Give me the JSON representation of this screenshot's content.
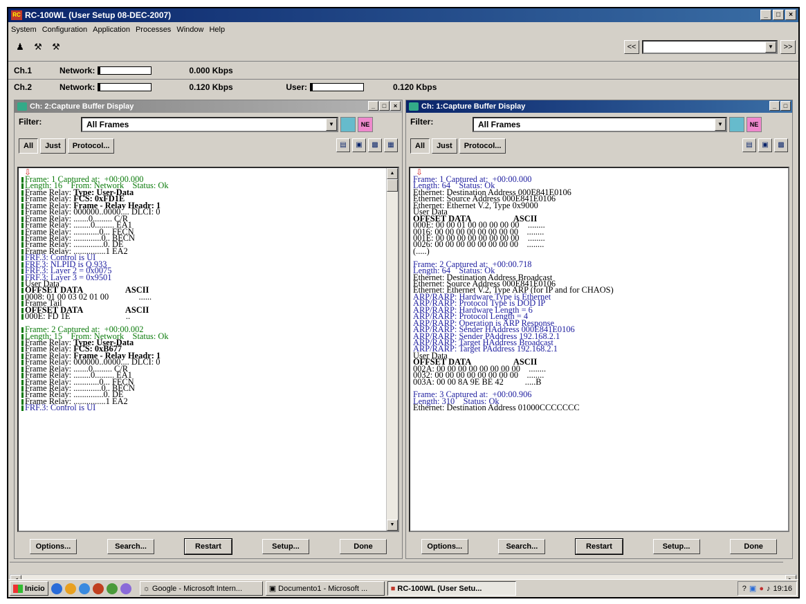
{
  "app": {
    "title": "RC-100WL (User Setup 08-DEC-2007)",
    "logo_text": "RC",
    "window_buttons": [
      "_",
      "□",
      "×"
    ]
  },
  "menu": [
    "System",
    "Configuration",
    "Application",
    "Processes",
    "Window",
    "Help"
  ],
  "nav": {
    "back": "<<",
    "forward": ">>",
    "combo_value": ""
  },
  "channels": [
    {
      "label": "Ch.1",
      "network_label": "Network:",
      "network_rate": "0.000 Kbps"
    },
    {
      "label": "Ch.2",
      "network_label": "Network:",
      "network_rate": "0.120 Kbps",
      "user_label": "User:",
      "user_rate": "0.120 Kbps"
    }
  ],
  "left_window": {
    "title": "Ch: 2:Capture Buffer Display",
    "filter_label": "Filter:",
    "filter_value": "All Frames",
    "buttons": {
      "all": "All",
      "just": "Just",
      "protocol": "Protocol..."
    },
    "lines": [
      {
        "c": "green",
        "t": "Frame: 1 Captured at:  +00:00.000",
        "m": true
      },
      {
        "c": "green",
        "t": "Length: 16    From: Network    Status: Ok",
        "m": true
      },
      {
        "c": "black",
        "t": "Frame Relay: ",
        "b": "Type: User-Data",
        "m": true
      },
      {
        "c": "black",
        "t": "Frame Relay: ",
        "b": "FCS: 0xFD1E",
        "m": true
      },
      {
        "c": "black",
        "t": "Frame Relay: ",
        "b": "Frame - Relay Headr: 1",
        "m": true
      },
      {
        "c": "black",
        "t": "Frame Relay: 000000..0000.... DLCI: 0",
        "m": true
      },
      {
        "c": "black",
        "t": "Frame Relay: .......0......... C/R",
        "m": true
      },
      {
        "c": "black",
        "t": "Frame Relay: ........0......... EA1",
        "m": true
      },
      {
        "c": "black",
        "t": "Frame Relay: ............0... FECN",
        "m": true
      },
      {
        "c": "black",
        "t": "Frame Relay: .............0.. BECN",
        "m": true
      },
      {
        "c": "black",
        "t": "Frame Relay: ..............0. DE",
        "m": true
      },
      {
        "c": "black",
        "t": "Frame Relay: ...............1 EA2",
        "m": true
      },
      {
        "c": "blue",
        "t": "FRF.3: Control is UI",
        "m": true
      },
      {
        "c": "blue",
        "t": "FRF.3: NLPID is Q.933",
        "m": true
      },
      {
        "c": "blue",
        "t": "FRF.3: Layer 2 = 0x0075",
        "m": true
      },
      {
        "c": "blue",
        "t": "FRF.3: Layer 3 = 0x9501",
        "m": true
      },
      {
        "c": "black",
        "t": "User Data",
        "m": true
      },
      {
        "c": "black",
        "t": "",
        "b": "OFFSET DATA                    ASCII",
        "m": true
      },
      {
        "c": "black",
        "t": "0008: 01 00 03 02 01 00              ......",
        "m": true
      },
      {
        "c": "black",
        "t": "Frame Tail",
        "m": true
      },
      {
        "c": "black",
        "t": "",
        "b": "OFFSET DATA                    ASCII",
        "m": true
      },
      {
        "c": "black",
        "t": "000E: FD 1E                          ..",
        "m": true
      },
      {
        "c": "black",
        "t": "",
        "m": false
      },
      {
        "c": "green",
        "t": "Frame: 2 Captured at:  +00:00.002",
        "m": true
      },
      {
        "c": "green",
        "t": "Length: 15    From: Network    Status: Ok",
        "m": true
      },
      {
        "c": "black",
        "t": "Frame Relay: ",
        "b": "Type: User-Data",
        "m": true
      },
      {
        "c": "black",
        "t": "Frame Relay: ",
        "b": "FCS: 0xB677",
        "m": true
      },
      {
        "c": "black",
        "t": "Frame Relay: ",
        "b": "Frame - Relay Headr: 1",
        "m": true
      },
      {
        "c": "black",
        "t": "Frame Relay: 000000..0000.... DLCI: 0",
        "m": true
      },
      {
        "c": "black",
        "t": "Frame Relay: .......0......... C/R",
        "m": true
      },
      {
        "c": "black",
        "t": "Frame Relay: ........0......... EA1",
        "m": true
      },
      {
        "c": "black",
        "t": "Frame Relay: ............0... FECN",
        "m": true
      },
      {
        "c": "black",
        "t": "Frame Relay: .............0.. BECN",
        "m": true
      },
      {
        "c": "black",
        "t": "Frame Relay: ..............0. DE",
        "m": true
      },
      {
        "c": "black",
        "t": "Frame Relay: ...............1 EA2",
        "m": true
      },
      {
        "c": "blue",
        "t": "FRF.3: Control is UI",
        "m": true
      }
    ],
    "bottom_buttons": [
      "Options...",
      "Search...",
      "Restart",
      "Setup...",
      "Done"
    ]
  },
  "right_window": {
    "title": "Ch: 1:Capture Buffer Display",
    "filter_label": "Filter:",
    "filter_value": "All Frames",
    "buttons": {
      "all": "All",
      "just": "Just",
      "protocol": "Protocol..."
    },
    "lines": [
      {
        "c": "blue",
        "t": "Frame: 1 Captured at:  +00:00.000"
      },
      {
        "c": "blue",
        "t": "Length: 64    Status: Ok"
      },
      {
        "c": "black",
        "t": "Ethernet: Destination Address 000E841E0106"
      },
      {
        "c": "black",
        "t": "Ethernet: Source Address 000E841E0106"
      },
      {
        "c": "black",
        "t": "Ethernet: Ethernet V.2, Type 0x9000"
      },
      {
        "c": "black",
        "t": "User Data"
      },
      {
        "c": "black",
        "t": "",
        "b": "OFFSET DATA                    ASCII"
      },
      {
        "c": "black",
        "t": "000E: 00 00 01 00 00 00 00 00    ........"
      },
      {
        "c": "black",
        "t": "0016: 00 00 00 00 00 00 00 00    ........"
      },
      {
        "c": "black",
        "t": "001E: 00 00 00 00 00 00 00 00    ........"
      },
      {
        "c": "black",
        "t": "0026: 00 00 00 00 00 00 00 00    ........"
      },
      {
        "c": "black",
        "t": "(.....)"
      },
      {
        "c": "black",
        "t": ""
      },
      {
        "c": "blue",
        "t": "Frame: 2 Captured at:  +00:00.718"
      },
      {
        "c": "blue",
        "t": "Length: 64    Status: Ok"
      },
      {
        "c": "black",
        "t": "Ethernet: Destination Address Broadcast"
      },
      {
        "c": "black",
        "t": "Ethernet: Source Address 000E841E0106"
      },
      {
        "c": "black",
        "t": "Ethernet: Ethernet V.2, Type ARP (for IP and for CHAOS)"
      },
      {
        "c": "blue",
        "t": "ARP/RARP: Hardware Type is Ethernet"
      },
      {
        "c": "blue",
        "t": "ARP/RARP: Protocol Type is DOD IP"
      },
      {
        "c": "blue",
        "t": "ARP/RARP: Hardware Length = 6"
      },
      {
        "c": "blue",
        "t": "ARP/RARP: Protocol Length = 4"
      },
      {
        "c": "blue",
        "t": "ARP/RARP: Operation is ARP Response"
      },
      {
        "c": "blue",
        "t": "ARP/RARP: Sender HAddress 000E841E0106"
      },
      {
        "c": "blue",
        "t": "ARP/RARP: Sender PAddress 192.168.2.1"
      },
      {
        "c": "blue",
        "t": "ARP/RARP: Target HAddress Broadcast"
      },
      {
        "c": "blue",
        "t": "ARP/RARP: Target PAddress 192.168.2.1"
      },
      {
        "c": "black",
        "t": "User Data"
      },
      {
        "c": "black",
        "t": "",
        "b": "OFFSET DATA                    ASCII"
      },
      {
        "c": "black",
        "t": "002A: 00 00 00 00 00 00 00 00    ........"
      },
      {
        "c": "black",
        "t": "0032: 00 00 00 00 00 00 00 00    ........"
      },
      {
        "c": "black",
        "t": "003A: 00 00 8A 9E BE 42          .....B"
      },
      {
        "c": "black",
        "t": ""
      },
      {
        "c": "blue",
        "t": "Frame: 3 Captured at:  +00:00.906"
      },
      {
        "c": "blue",
        "t": "Length: 310    Status: Ok"
      },
      {
        "c": "black",
        "t": "Ethernet: Destination Address 01000CCCCCCC"
      }
    ],
    "bottom_buttons": [
      "Options...",
      "Search...",
      "Restart",
      "Setup...",
      "Done"
    ]
  },
  "taskbar": {
    "start": "Inicio",
    "tasks": [
      "Google - Microsoft Intern...",
      "Documento1 - Microsoft ...",
      "RC-100WL (User Setu..."
    ],
    "clock": "19:16"
  },
  "colors": {
    "title_active": "#0a246a",
    "text_green": "#0a7a0a",
    "text_blue": "#2020a0",
    "face": "#d4d0c8"
  }
}
